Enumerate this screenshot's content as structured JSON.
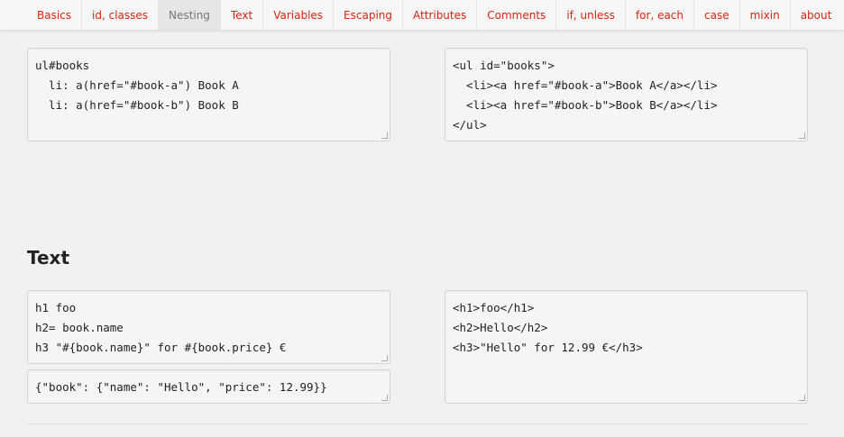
{
  "nav": {
    "items": [
      {
        "label": "Basics"
      },
      {
        "label": "id, classes"
      },
      {
        "label": "Nesting"
      },
      {
        "label": "Text"
      },
      {
        "label": "Variables"
      },
      {
        "label": "Escaping"
      },
      {
        "label": "Attributes"
      },
      {
        "label": "Comments"
      },
      {
        "label": "if, unless"
      },
      {
        "label": "for, each"
      },
      {
        "label": "case"
      },
      {
        "label": "mixin"
      },
      {
        "label": "about"
      }
    ],
    "active": "Nesting",
    "link_color": "#d9230f"
  },
  "nesting": {
    "input": "ul#books\n  li: a(href=\"#book-a\") Book A\n  li: a(href=\"#book-b\") Book B",
    "output": "<ul id=\"books\">\n  <li><a href=\"#book-a\">Book A</a></li>\n  <li><a href=\"#book-b\">Book B</a></li>\n</ul>"
  },
  "text_section": {
    "title": "Text",
    "input": "h1 foo\nh2= book.name\nh3 \"#{book.name}\" for #{book.price} €",
    "data": "{\"book\": {\"name\": \"Hello\", \"price\": 12.99}}",
    "output": "<h1>foo</h1>\n<h2>Hello</h2>\n<h3>\"Hello\" for 12.99 €</h3>"
  }
}
